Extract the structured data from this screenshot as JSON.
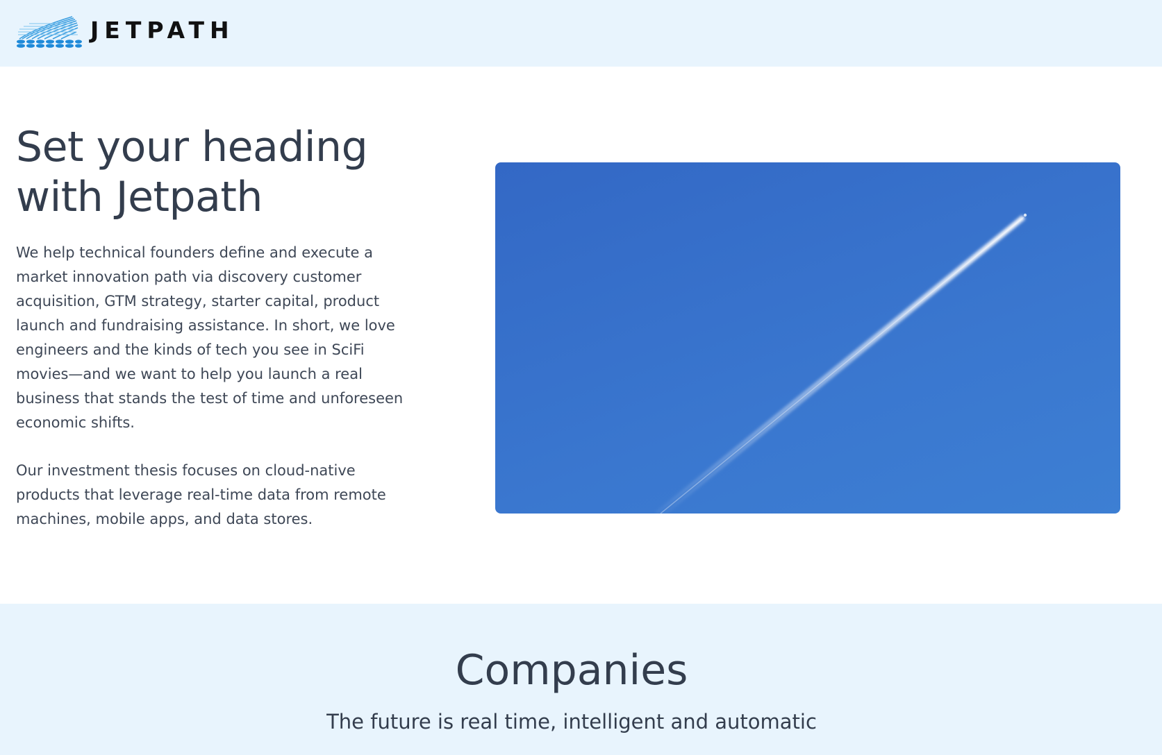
{
  "header": {
    "logo_text": "JETPATH",
    "logo_icon": "jetpath-wave-logo-icon",
    "background": "#e8f4fd"
  },
  "hero": {
    "title_line1": "Set your heading",
    "title_line2": "with Jetpath",
    "paragraph1": "We help technical founders define and execute a market innovation path via discovery customer acquisition, GTM strategy, starter capital, product launch and fundraising assistance. In short, we love engineers and the kinds of tech you see in SciFi movies—and we want to help you launch a real business that stands the test of time and unforeseen economic shifts.",
    "paragraph2": "Our investment thesis focuses on cloud-native products that leverage real-time data from remote machines, mobile apps, and data stores.",
    "image": "jet-contrail-blue-sky-image",
    "sky_color": "#3a74cd"
  },
  "companies": {
    "title": "Companies",
    "subtitle": "The future is real time, intelligent and automatic",
    "background": "#e8f4fd"
  }
}
